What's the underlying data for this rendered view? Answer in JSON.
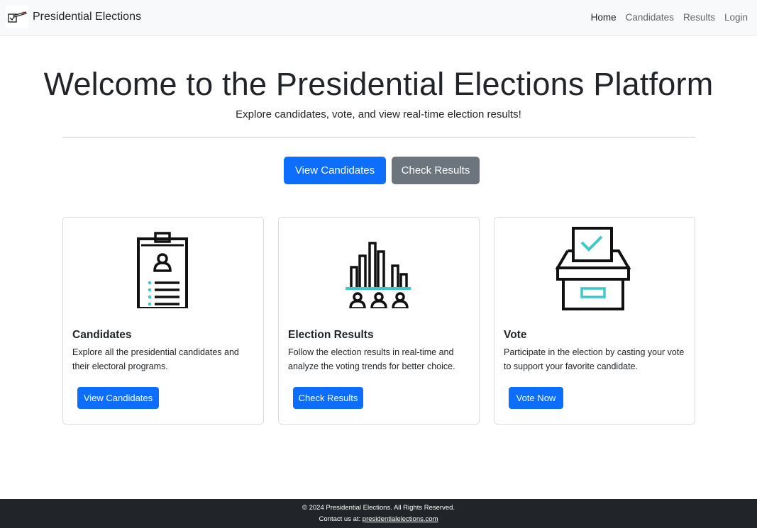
{
  "navbar": {
    "brand": "Presidential Elections",
    "brand_icon": "ballot-logo-icon",
    "links": [
      "Home",
      "Candidates",
      "Results",
      "Login"
    ]
  },
  "hero": {
    "title": "Welcome to the Presidential Elections Platform",
    "subtitle": "Explore candidates, vote, and view real-time election results!",
    "primary_button": "View Candidates",
    "secondary_button": "Check Results"
  },
  "cards": [
    {
      "icon": "candidate-id-badge-icon",
      "title": "Candidates",
      "text": "Explore all the presidential candidates and their electoral programs.",
      "button": "View Candidates"
    },
    {
      "icon": "election-results-chart-icon",
      "title": "Election Results",
      "text": "Follow the election results in real-time and analyze the voting trends for better choice.",
      "button": "Check Results"
    },
    {
      "icon": "ballot-box-icon",
      "title": "Vote",
      "text": "Participate in the election by casting your vote to support your favorite candidate.",
      "button": "Vote Now"
    }
  ],
  "footer": {
    "copyright": "© 2024 Presidential Elections. All Rights Reserved.",
    "contact_label": "Contact us at: ",
    "contact_link": "presidentialelections.com"
  },
  "colors": {
    "primary": "#0d6efd",
    "secondary": "#6c757d",
    "accent_teal": "#3cc8c8",
    "footer_bg": "#212529",
    "navbar_bg": "#f8f9fa"
  }
}
